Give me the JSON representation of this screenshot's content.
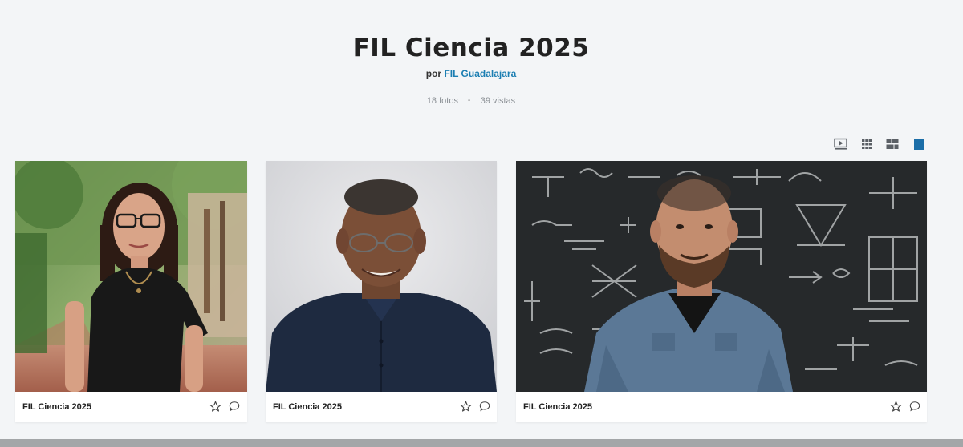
{
  "album": {
    "title": "FIL Ciencia 2025",
    "by_prefix": "por",
    "owner": "FIL Guadalajara",
    "photo_count": "18 fotos",
    "separator": "·",
    "views": "39 vistas"
  },
  "view_modes": [
    {
      "name": "slideshow",
      "icon": "slideshow-icon"
    },
    {
      "name": "grid",
      "icon": "grid-icon"
    },
    {
      "name": "mosaic",
      "icon": "mosaic-icon"
    },
    {
      "name": "single",
      "icon": "single-view-icon",
      "active": true
    }
  ],
  "photos": [
    {
      "caption": "FIL Ciencia 2025",
      "subject": "woman-glasses-black-top"
    },
    {
      "caption": "FIL Ciencia 2025",
      "subject": "man-glasses-navy-shirt"
    },
    {
      "caption": "FIL Ciencia 2025",
      "subject": "man-beard-denim-blackboard"
    }
  ],
  "colors": {
    "accent": "#1b7eb2",
    "background": "#f3f5f7",
    "active_view": "#1b6ea8"
  }
}
